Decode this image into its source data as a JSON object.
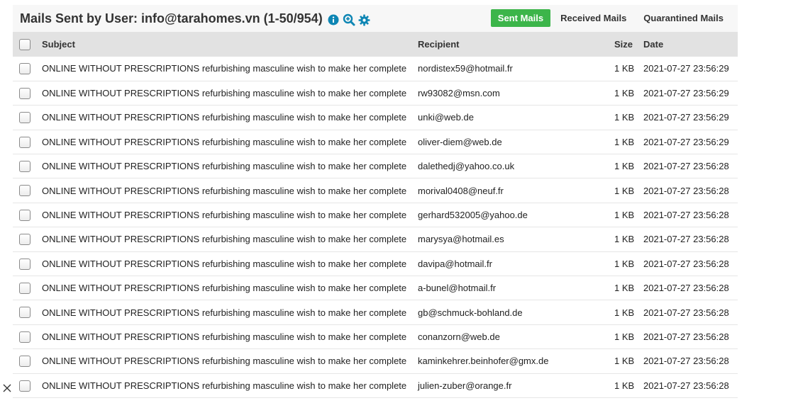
{
  "header": {
    "title": "Mails Sent by User: info@tarahomes.vn (1-50/954)",
    "icons": [
      "info-icon",
      "zoom-icon",
      "gear-icon"
    ],
    "accent_color": "#0e86b4"
  },
  "tabs": [
    {
      "label": "Sent Mails",
      "active": true,
      "color": "#3cb54a"
    },
    {
      "label": "Received Mails",
      "active": false
    },
    {
      "label": "Quarantined Mails",
      "active": false
    }
  ],
  "table": {
    "columns": [
      "Subject",
      "Recipient",
      "Size",
      "Date"
    ],
    "rows": [
      {
        "subject": "ONLINE WITHOUT PRESCRIPTIONS refurbishing masculine wish to make her complete",
        "recipient": "nordistex59@hotmail.fr",
        "size": "1 KB",
        "date": "2021-07-27 23:56:29"
      },
      {
        "subject": "ONLINE WITHOUT PRESCRIPTIONS refurbishing masculine wish to make her complete",
        "recipient": "rw93082@msn.com",
        "size": "1 KB",
        "date": "2021-07-27 23:56:29"
      },
      {
        "subject": "ONLINE WITHOUT PRESCRIPTIONS refurbishing masculine wish to make her complete",
        "recipient": "unki@web.de",
        "size": "1 KB",
        "date": "2021-07-27 23:56:29"
      },
      {
        "subject": "ONLINE WITHOUT PRESCRIPTIONS refurbishing masculine wish to make her complete",
        "recipient": "oliver-diem@web.de",
        "size": "1 KB",
        "date": "2021-07-27 23:56:29"
      },
      {
        "subject": "ONLINE WITHOUT PRESCRIPTIONS refurbishing masculine wish to make her complete",
        "recipient": "dalethedj@yahoo.co.uk",
        "size": "1 KB",
        "date": "2021-07-27 23:56:28"
      },
      {
        "subject": "ONLINE WITHOUT PRESCRIPTIONS refurbishing masculine wish to make her complete",
        "recipient": "morival0408@neuf.fr",
        "size": "1 KB",
        "date": "2021-07-27 23:56:28"
      },
      {
        "subject": "ONLINE WITHOUT PRESCRIPTIONS refurbishing masculine wish to make her complete",
        "recipient": "gerhard532005@yahoo.de",
        "size": "1 KB",
        "date": "2021-07-27 23:56:28"
      },
      {
        "subject": "ONLINE WITHOUT PRESCRIPTIONS refurbishing masculine wish to make her complete",
        "recipient": "marysya@hotmail.es",
        "size": "1 KB",
        "date": "2021-07-27 23:56:28"
      },
      {
        "subject": "ONLINE WITHOUT PRESCRIPTIONS refurbishing masculine wish to make her complete",
        "recipient": "davipa@hotmail.fr",
        "size": "1 KB",
        "date": "2021-07-27 23:56:28"
      },
      {
        "subject": "ONLINE WITHOUT PRESCRIPTIONS refurbishing masculine wish to make her complete",
        "recipient": "a-bunel@hotmail.fr",
        "size": "1 KB",
        "date": "2021-07-27 23:56:28"
      },
      {
        "subject": "ONLINE WITHOUT PRESCRIPTIONS refurbishing masculine wish to make her complete",
        "recipient": "gb@schmuck-bohland.de",
        "size": "1 KB",
        "date": "2021-07-27 23:56:28"
      },
      {
        "subject": "ONLINE WITHOUT PRESCRIPTIONS refurbishing masculine wish to make her complete",
        "recipient": "conanzorn@web.de",
        "size": "1 KB",
        "date": "2021-07-27 23:56:28"
      },
      {
        "subject": "ONLINE WITHOUT PRESCRIPTIONS refurbishing masculine wish to make her complete",
        "recipient": "kaminkehrer.beinhofer@gmx.de",
        "size": "1 KB",
        "date": "2021-07-27 23:56:28"
      },
      {
        "subject": "ONLINE WITHOUT PRESCRIPTIONS refurbishing masculine wish to make her complete",
        "recipient": "julien-zuber@orange.fr",
        "size": "1 KB",
        "date": "2021-07-27 23:56:28"
      }
    ]
  },
  "overlay": {
    "close_icon": "close-icon"
  }
}
